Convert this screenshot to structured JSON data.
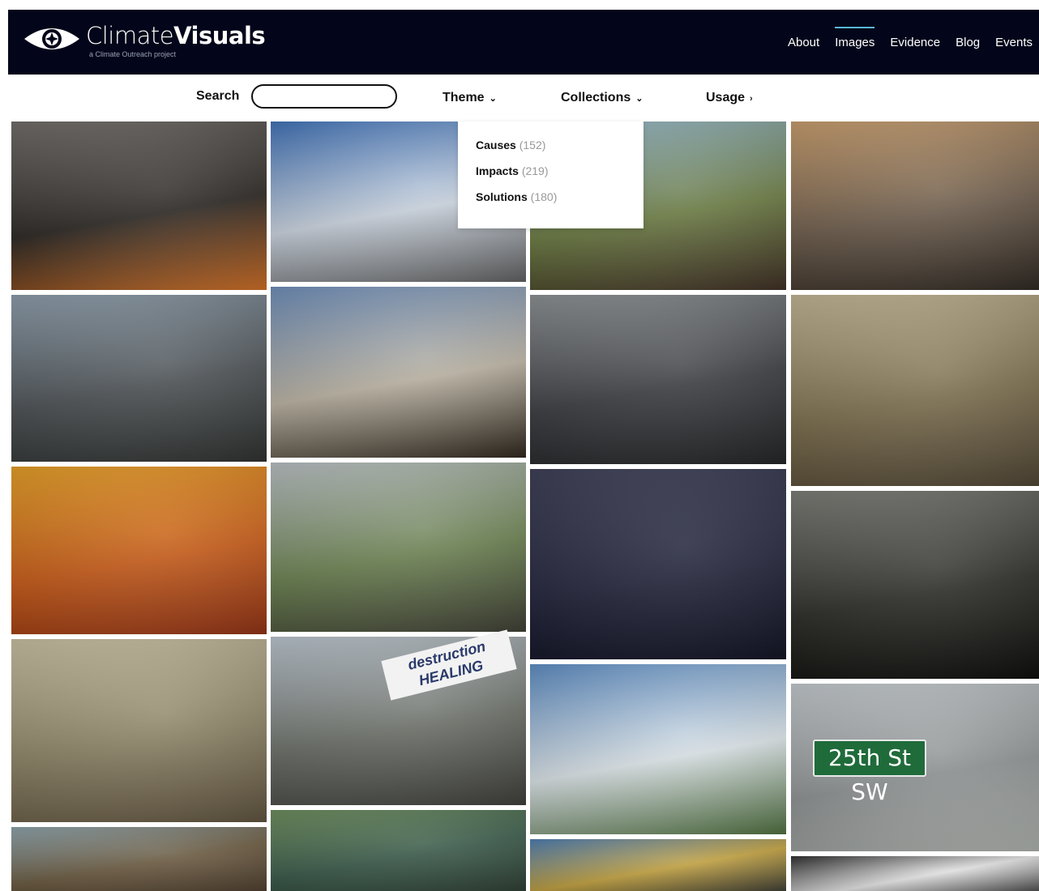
{
  "header": {
    "brand_light": "Climate",
    "brand_bold": "Visuals",
    "brand_sub": "a Climate Outreach project",
    "nav": [
      "About",
      "Images",
      "Evidence",
      "Blog",
      "Events"
    ],
    "active_nav": "Images",
    "accent_color": "#58b7d6",
    "background": "#03061a"
  },
  "toolbar": {
    "search_label": "Search",
    "search_value": "",
    "theme_label": "Theme",
    "collections_label": "Collections",
    "usage_label": "Usage"
  },
  "theme_dropdown": {
    "items": [
      {
        "label": "Causes",
        "count": "(152)"
      },
      {
        "label": "Impacts",
        "count": "(219)"
      },
      {
        "label": "Solutions",
        "count": "(180)"
      }
    ]
  },
  "gallery": {
    "tiles": [
      {
        "name": "tile-bushfire-workers",
        "icon": "photo-icon",
        "colors": [
          "#6e6a66",
          "#2a2622",
          "#c96a22"
        ]
      },
      {
        "name": "tile-smokestacks",
        "icon": "photo-icon",
        "colors": [
          "#3d6fb4",
          "#c8d1dc",
          "#5a5a5a"
        ]
      },
      {
        "name": "tile-dirt-road-clearcut",
        "icon": "photo-icon",
        "colors": [
          "#8fb2c8",
          "#6a7a42",
          "#3a2a20"
        ]
      },
      {
        "name": "tile-aerial-mining",
        "icon": "photo-icon",
        "colors": [
          "#c49a6a",
          "#6a5a4a",
          "#2a241e"
        ]
      },
      {
        "name": "tile-solar-panel-mountains",
        "icon": "photo-icon",
        "colors": [
          "#8a9aa8",
          "#4a4f52",
          "#2a2c2a"
        ]
      },
      {
        "name": "tile-industrial-waste-pond",
        "icon": "photo-icon",
        "colors": [
          "#6b8bb6",
          "#b8b0a0",
          "#2a2218"
        ]
      },
      {
        "name": "tile-truck-driver",
        "icon": "photo-icon",
        "colors": [
          "#8a8e90",
          "#3a3c40",
          "#1e2022"
        ]
      },
      {
        "name": "tile-aerial-plantation",
        "icon": "photo-icon",
        "colors": [
          "#bfb290",
          "#7a6c4c",
          "#4a4030"
        ]
      },
      {
        "name": "tile-dust-storm",
        "icon": "photo-icon",
        "colors": [
          "#e19b24",
          "#c45a18",
          "#8a2e12"
        ]
      },
      {
        "name": "tile-man-oily-hands",
        "icon": "photo-icon",
        "colors": [
          "#b6bcc0",
          "#6a8050",
          "#3a3a30"
        ]
      },
      {
        "name": "tile-coal-mound",
        "icon": "photo-icon",
        "colors": [
          "#3a3c52",
          "#22243a",
          "#0e1020"
        ]
      },
      {
        "name": "tile-flooded-street-silhouettes",
        "icon": "photo-icon",
        "colors": [
          "#7a7a74",
          "#2a2a26",
          "#0a0a08"
        ]
      },
      {
        "name": "tile-cracked-earth",
        "icon": "photo-icon",
        "colors": [
          "#c6bca0",
          "#8a8064",
          "#5a4e3a"
        ]
      },
      {
        "name": "tile-protest-march",
        "icon": "photo-icon",
        "colors": [
          "#b8c2cc",
          "#6a6e66",
          "#3a3a36"
        ]
      },
      {
        "name": "tile-glacier-photo",
        "icon": "photo-icon",
        "colors": [
          "#5a8ac0",
          "#d8e0e4",
          "#4a6a3a"
        ]
      },
      {
        "name": "tile-flood-street-sign",
        "icon": "photo-icon",
        "colors": [
          "#c0c6ca",
          "#8c9090",
          "#a8aca8"
        ]
      },
      {
        "name": "tile-flooded-building",
        "icon": "photo-icon",
        "colors": [
          "#8aa0a8",
          "#6a5a40",
          "#4a3a2a"
        ]
      },
      {
        "name": "tile-road-sign-water",
        "icon": "photo-icon",
        "colors": [
          "#6a8a5a",
          "#3a5a4a",
          "#2a3a30"
        ]
      },
      {
        "name": "tile-bulldozer-protest",
        "icon": "photo-icon",
        "colors": [
          "#4a7ab0",
          "#c0a040",
          "#3a3a30"
        ]
      },
      {
        "name": "tile-car-interior",
        "icon": "photo-icon",
        "colors": [
          "#2a2a2a",
          "#e0e0e0",
          "#4a4a4a"
        ]
      }
    ]
  },
  "street_sign_text": "25th St SW",
  "protest_banner_text": "destruction HEALING"
}
